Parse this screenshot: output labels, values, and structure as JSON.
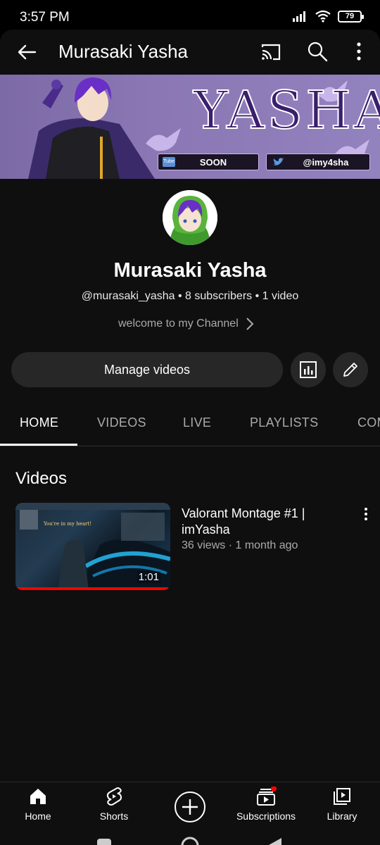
{
  "status": {
    "time": "3:57 PM",
    "battery": "79"
  },
  "topbar": {
    "title": "Murasaki Yasha"
  },
  "banner": {
    "title_text": "YASHA",
    "pill_left": "SOON",
    "pill_right": "@imy4sha",
    "yt_tag": "Tube"
  },
  "channel": {
    "name": "Murasaki Yasha",
    "meta": "@murasaki_yasha • 8 subscribers • 1 video",
    "description": "welcome to my Channel"
  },
  "actions": {
    "manage_label": "Manage videos"
  },
  "tabs": [
    {
      "label": "HOME",
      "active": true
    },
    {
      "label": "VIDEOS"
    },
    {
      "label": "LIVE"
    },
    {
      "label": "PLAYLISTS"
    },
    {
      "label": "COM"
    }
  ],
  "section": {
    "title": "Videos"
  },
  "videos": [
    {
      "title": "Valorant Montage #1 | imYasha",
      "meta": "36 views · 1 month ago",
      "duration": "1:01",
      "thumb_caption": "You're in my heart!"
    }
  ],
  "bottom_nav": [
    {
      "label": "Home",
      "icon": "home-icon"
    },
    {
      "label": "Shorts",
      "icon": "shorts-icon"
    },
    {
      "label": "",
      "icon": "create-icon"
    },
    {
      "label": "Subscriptions",
      "icon": "subscriptions-icon"
    },
    {
      "label": "Library",
      "icon": "library-icon"
    }
  ],
  "colors": {
    "background": "#0f0f0f",
    "button": "#272727",
    "progress": "#ff0000",
    "secondary_text": "#aaaaaa"
  }
}
